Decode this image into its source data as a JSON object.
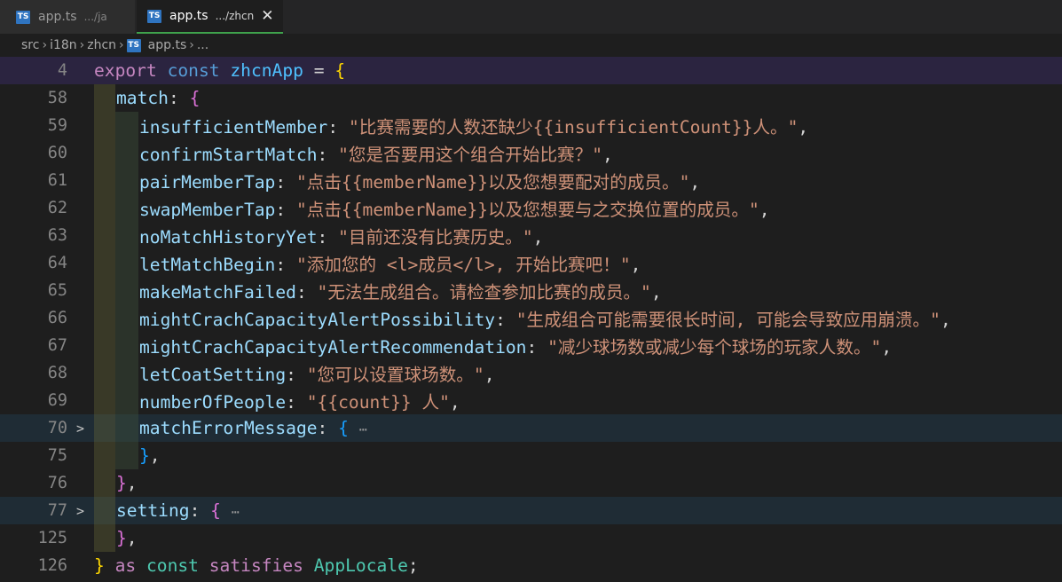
{
  "tabs": [
    {
      "name": "app.ts",
      "path": ".../ja",
      "active": false
    },
    {
      "name": "app.ts",
      "path": ".../zhcn",
      "active": true
    }
  ],
  "tab_icon": "TS",
  "close_glyph": "✕",
  "breadcrumb": {
    "items": [
      "src",
      "i18n",
      "zhcn"
    ],
    "file": "app.ts",
    "trailing": "..."
  },
  "colors": {
    "sticky_bg": "#2b2440",
    "accent_tab": "#3fa24c",
    "keyword": "#569cd6",
    "string": "#ce9178",
    "property": "#9cdcfe"
  },
  "editor": {
    "l4": {
      "num": "4",
      "export": "export",
      "const": "const",
      "name": "zhcnApp",
      "eq": " = ",
      "open": "{"
    },
    "l58": {
      "num": "58",
      "key": "match",
      "open": "{"
    },
    "l59": {
      "num": "59",
      "key": "insufficientMember",
      "value": "\"比赛需要的人数还缺少{{insufficientCount}}人。\""
    },
    "l60": {
      "num": "60",
      "key": "confirmStartMatch",
      "value": "\"您是否要用这个组合开始比赛？\""
    },
    "l61": {
      "num": "61",
      "key": "pairMemberTap",
      "value": "\"点击{{memberName}}以及您想要配对的成员。\""
    },
    "l62": {
      "num": "62",
      "key": "swapMemberTap",
      "value": "\"点击{{memberName}}以及您想要与之交换位置的成员。\""
    },
    "l63": {
      "num": "63",
      "key": "noMatchHistoryYet",
      "value": "\"目前还没有比赛历史。\""
    },
    "l64": {
      "num": "64",
      "key": "letMatchBegin",
      "value": "\"添加您的 <l>成员</l>, 开始比赛吧！\""
    },
    "l65": {
      "num": "65",
      "key": "makeMatchFailed",
      "value": "\"无法生成组合。请检查参加比赛的成员。\""
    },
    "l66": {
      "num": "66",
      "key": "mightCrachCapacityAlertPossibility",
      "value": "\"生成组合可能需要很长时间, 可能会导致应用崩溃。\""
    },
    "l67": {
      "num": "67",
      "key": "mightCrachCapacityAlertRecommendation",
      "value": "\"减少球场数或减少每个球场的玩家人数。\""
    },
    "l68": {
      "num": "68",
      "key": "letCoatSetting",
      "value": "\"您可以设置球场数。\""
    },
    "l69": {
      "num": "69",
      "key": "numberOfPeople",
      "value": "\"{{count}} 人\""
    },
    "l70": {
      "num": "70",
      "key": "matchErrorMessage",
      "open": "{",
      "ellipsis": "⋯"
    },
    "l75": {
      "num": "75",
      "close": "}"
    },
    "l76": {
      "num": "76",
      "close": "}"
    },
    "l77": {
      "num": "77",
      "key": "setting",
      "open": "{",
      "ellipsis": "⋯"
    },
    "l125": {
      "num": "125",
      "close": "}"
    },
    "l126": {
      "num": "126",
      "close": "}",
      "as": "as",
      "const": "const",
      "satisfies": "satisfies",
      "type": "AppLocale"
    }
  }
}
